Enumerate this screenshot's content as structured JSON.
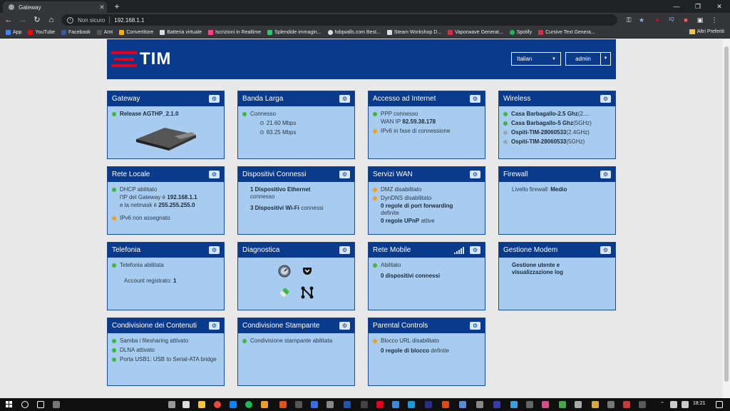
{
  "browser": {
    "tab_title": "Gateway",
    "address_insecure": "Non sicuro",
    "url": "192.168.1.1",
    "bookmarks": [
      {
        "label": "App",
        "color": "#4285f4"
      },
      {
        "label": "YouTube",
        "color": "#ff0000"
      },
      {
        "label": "Facebook",
        "color": "#3b5998"
      },
      {
        "label": "Amt",
        "color": "#555555"
      },
      {
        "label": "Convertitore",
        "color": "#f4b400"
      },
      {
        "label": "Batteria virtuale",
        "color": "#dddddd"
      },
      {
        "label": "Iscrizioni in Realtime",
        "color": "#ff4488"
      },
      {
        "label": "Splendide immagin...",
        "color": "#2ec866"
      },
      {
        "label": "hdqwalls.com Best...",
        "color": "#dddddd"
      },
      {
        "label": "Steam Workshop D...",
        "color": "#dddddd"
      },
      {
        "label": "Vaporwave Generat...",
        "color": "#cc3344"
      },
      {
        "label": "Spotify",
        "color": "#1db954"
      },
      {
        "label": "Cursive Text Genera...",
        "color": "#cc3344"
      }
    ],
    "other_bookmarks": "Altri Preferiti"
  },
  "header": {
    "logo": "TIM",
    "language": "Italian",
    "user": "admin"
  },
  "cards": {
    "gateway": {
      "title": "Gateway",
      "release": "Release AGTHP_2.1.0"
    },
    "banda_larga": {
      "title": "Banda Larga",
      "status": "Connesso",
      "down": "21.60 Mbps",
      "up": "83.25 Mbps"
    },
    "accesso_internet": {
      "title": "Accesso ad Internet",
      "ppp": "PPP connesso",
      "wan_label": "WAN IP",
      "wan_ip": "82.59.38.178",
      "ipv6": "IPv6 in fase di connessione"
    },
    "wireless": {
      "title": "Wireless",
      "ssid1": "Casa Barbagallo-2.5 Ghz",
      "ssid1_suffix": "(2....",
      "ssid2": "Casa Barbagallo-5 Ghz",
      "ssid2_suffix": "(5GHz)",
      "ssid3": "Ospiti-TIM-28060533",
      "ssid3_suffix": "(2.4GHz)",
      "ssid4": "Ospiti-TIM-28060533",
      "ssid4_suffix": "(5GHz)"
    },
    "rete_locale": {
      "title": "Rete Locale",
      "dhcp": "DHCP abilitato",
      "ip_prefix": "l'IP del Gateway è",
      "ip": "192.168.1.1",
      "netmask_prefix": "e la netmask è",
      "netmask": "255.255.255.0",
      "ipv6": "IPv6 non assegnato"
    },
    "dispositivi": {
      "title": "Dispositivi Connessi",
      "ethernet_bold": "1 Dispositivo Ethernet",
      "ethernet_rest": "connesso",
      "wifi_bold": "3 Dispositivi Wi-Fi",
      "wifi_rest": "connessi"
    },
    "servizi_wan": {
      "title": "Servizi WAN",
      "dmz": "DMZ disabilitato",
      "dyndns": "DynDNS disabilitato",
      "port_fw_bold": "0 regole di port forwarding",
      "port_fw_rest": "definite",
      "upnp_bold": "0 regole UPnP",
      "upnp_rest": "attive"
    },
    "firewall": {
      "title": "Firewall",
      "level_label": "Livello firewall:",
      "level": "Medio"
    },
    "telefonia": {
      "title": "Telefonia",
      "status": "Telefonia abilitata",
      "accounts_label": "Account registrato:",
      "accounts": "1"
    },
    "diagnostica": {
      "title": "Diagnostica"
    },
    "rete_mobile": {
      "title": "Rete Mobile",
      "status": "Abilitato",
      "devices": "0 dispositivi connessi"
    },
    "gestione_modem": {
      "title": "Gestione Modem",
      "text": "Gestione utente e visualizzazione log"
    },
    "condivisione_contenuti": {
      "title": "Condivisione dei Contenuti",
      "samba": "Samba i filesharing attivato",
      "dlna": "DLNA attivato",
      "usb": "Porta USB1: USB to Serial-ATA bridge"
    },
    "condivisione_stampante": {
      "title": "Condivisione Stampante",
      "status": "Condivisione stampante abilitata"
    },
    "parental": {
      "title": "Parental Controls",
      "url_block": "Blocco URL disabilitato",
      "rules_bold": "0 regole di blocco",
      "rules_rest": "definite"
    }
  },
  "taskbar": {
    "clock": "18:21"
  },
  "colors": {
    "header_blue": "#0a3a8c",
    "card_blue": "#a8ccf0",
    "tim_red": "#e2001a",
    "status_green": "#3cb93c",
    "status_orange": "#f0a020"
  }
}
